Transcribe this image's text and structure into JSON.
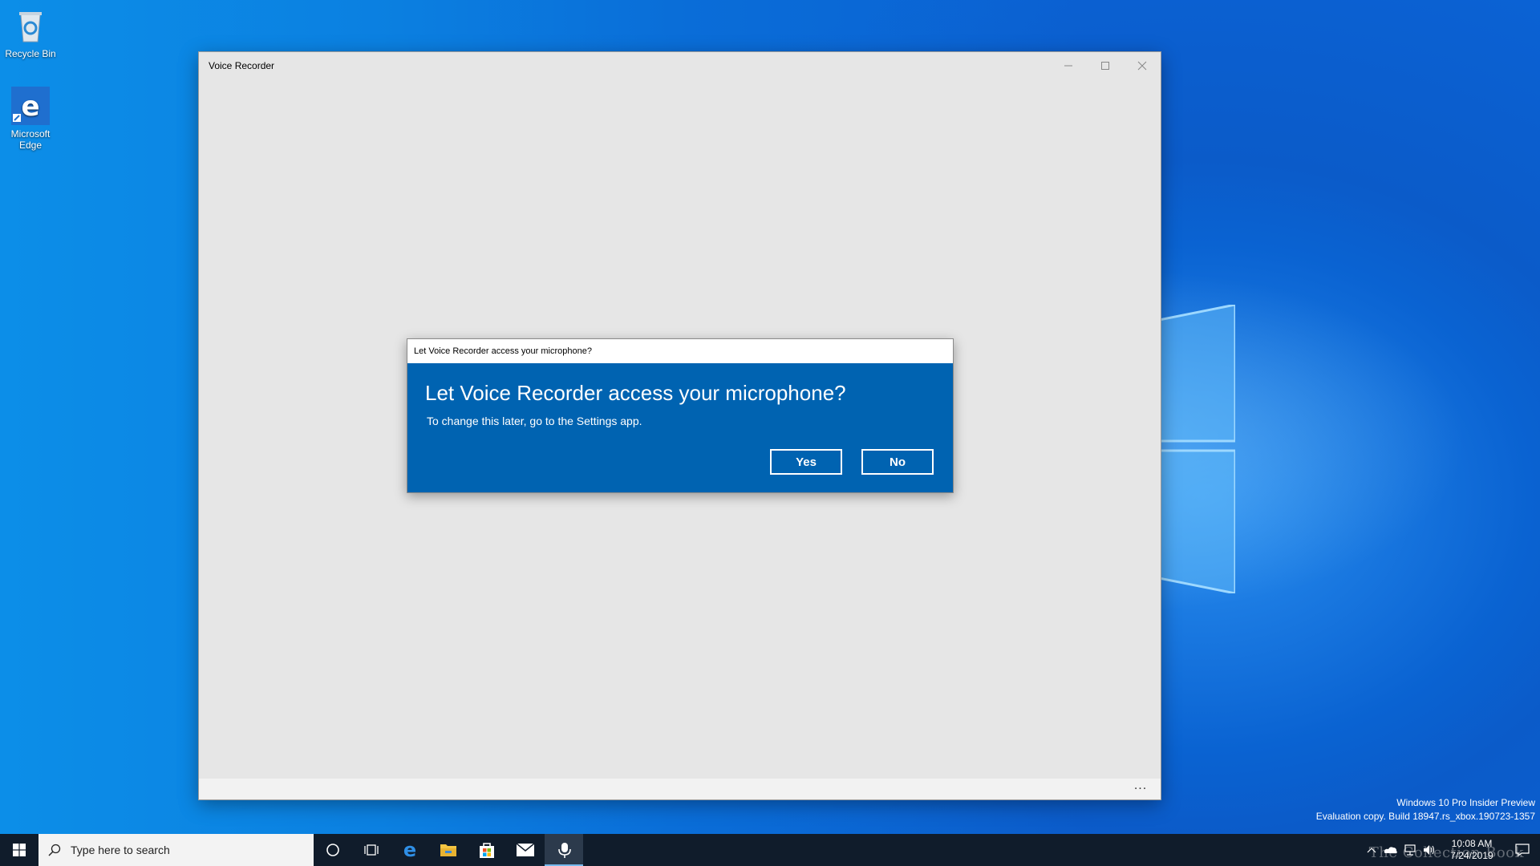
{
  "desktop": {
    "icons": [
      {
        "label": "Recycle Bin",
        "icon": "recycle-bin-icon"
      },
      {
        "label": "Microsoft Edge",
        "icon": "edge-icon"
      }
    ]
  },
  "app_window": {
    "title": "Voice Recorder",
    "more_label": "..."
  },
  "dialog": {
    "window_title": "Let Voice Recorder access your microphone?",
    "heading": "Let Voice Recorder access your microphone?",
    "subtext": "To change this later, go to the Settings app.",
    "yes_label": "Yes",
    "no_label": "No",
    "accent_color": "#0063b1"
  },
  "watermark": {
    "line1": "Windows 10 Pro Insider Preview",
    "line2": "Evaluation copy. Build 18947.rs_xbox.190723-1357"
  },
  "taskbar": {
    "search_placeholder": "Type here to search",
    "pinned": [
      "cortana-icon",
      "task-view-icon",
      "edge-icon",
      "file-explorer-icon",
      "store-icon",
      "mail-icon",
      "voice-recorder-icon"
    ],
    "clock_time": "10:08 AM",
    "clock_date": "7/24/2019",
    "brand_overlay": "The Collection Book"
  }
}
